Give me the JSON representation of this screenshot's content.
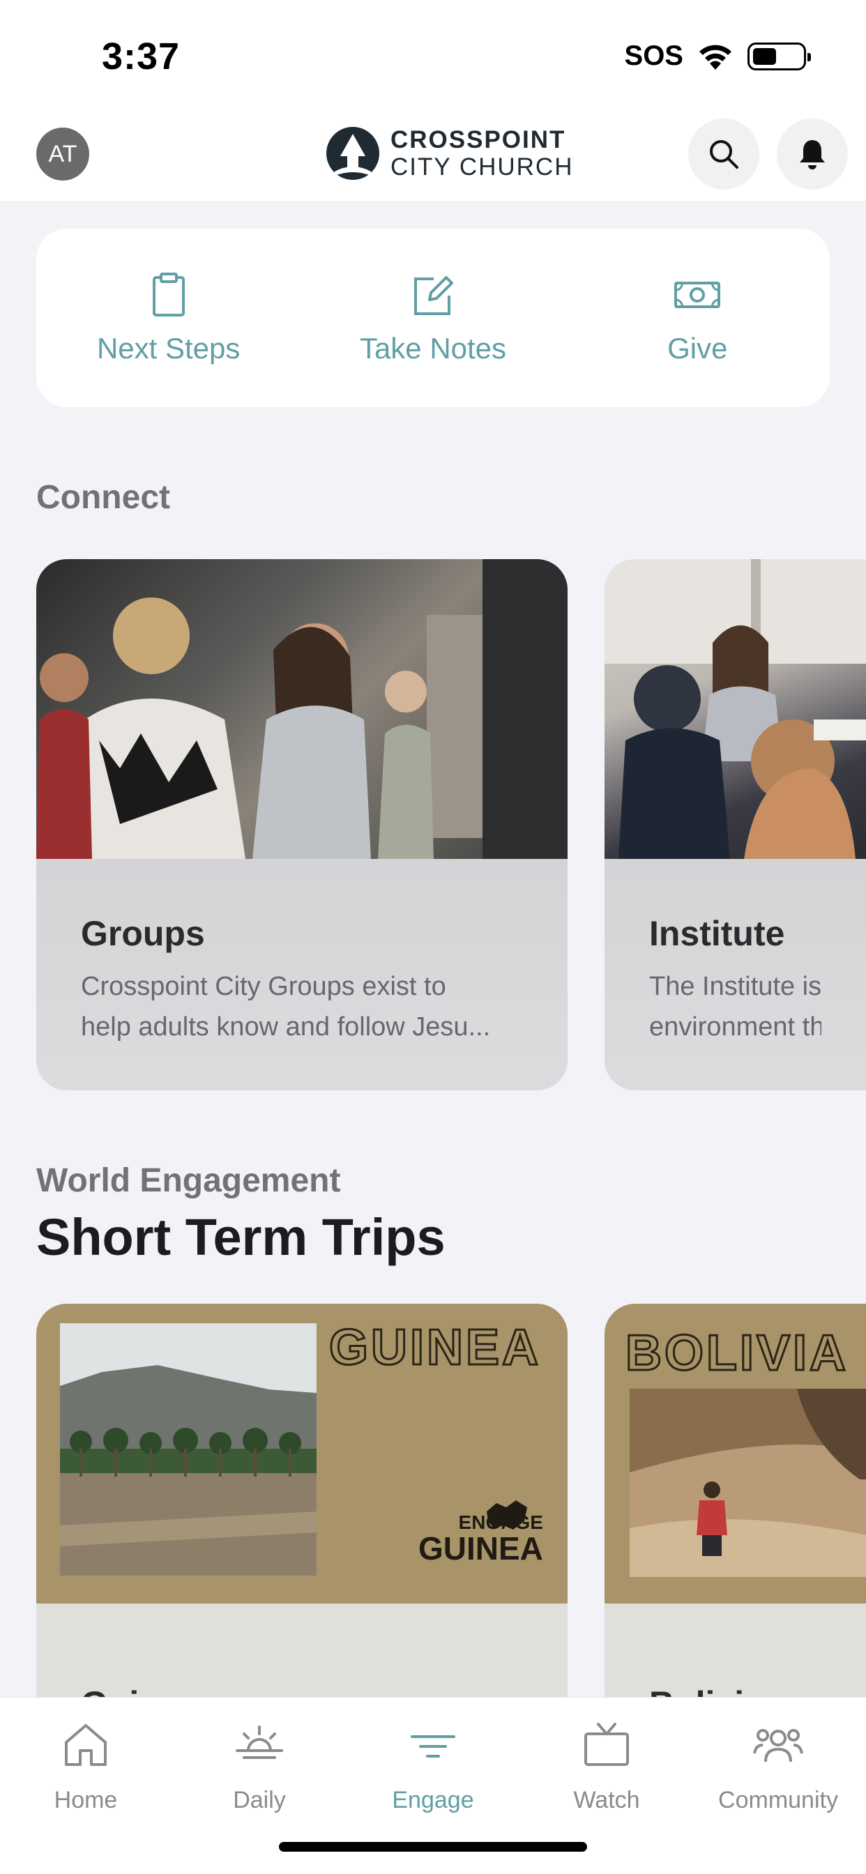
{
  "status": {
    "time": "3:37",
    "sos": "SOS",
    "battery_level": 0.5
  },
  "header": {
    "avatar_initials": "AT",
    "logo_line1": "CROSSPOINT",
    "logo_line2": "CITY CHURCH"
  },
  "quick_actions": [
    {
      "label": "Next Steps",
      "icon": "clipboard-icon"
    },
    {
      "label": "Take Notes",
      "icon": "edit-note-icon"
    },
    {
      "label": "Give",
      "icon": "money-icon"
    }
  ],
  "connect": {
    "label": "Connect",
    "cards": [
      {
        "title": "Groups",
        "desc_line1": "Crosspoint City Groups exist to",
        "desc_line2": "help adults know and follow Jesu..."
      },
      {
        "title": "Institute",
        "desc_line1": "The Institute is a l",
        "desc_line2": "environment that"
      }
    ]
  },
  "world": {
    "label": "World Engagement",
    "title": "Short Term Trips",
    "cards": [
      {
        "banner": "GUINEA",
        "badge_top": "ENGAGE",
        "badge_bottom": "GUINEA",
        "title": "Guinea"
      },
      {
        "banner": "BOLIVIA",
        "title": "Bolivia"
      }
    ]
  },
  "tabbar": {
    "items": [
      {
        "label": "Home",
        "icon": "home-icon"
      },
      {
        "label": "Daily",
        "icon": "sunrise-icon"
      },
      {
        "label": "Engage",
        "icon": "engage-icon",
        "active": true
      },
      {
        "label": "Watch",
        "icon": "tv-icon"
      },
      {
        "label": "Community",
        "icon": "community-icon"
      }
    ]
  },
  "colors": {
    "accent": "#5f9fa5",
    "trip_gold": "#a89468",
    "background": "#f3f3f7"
  }
}
